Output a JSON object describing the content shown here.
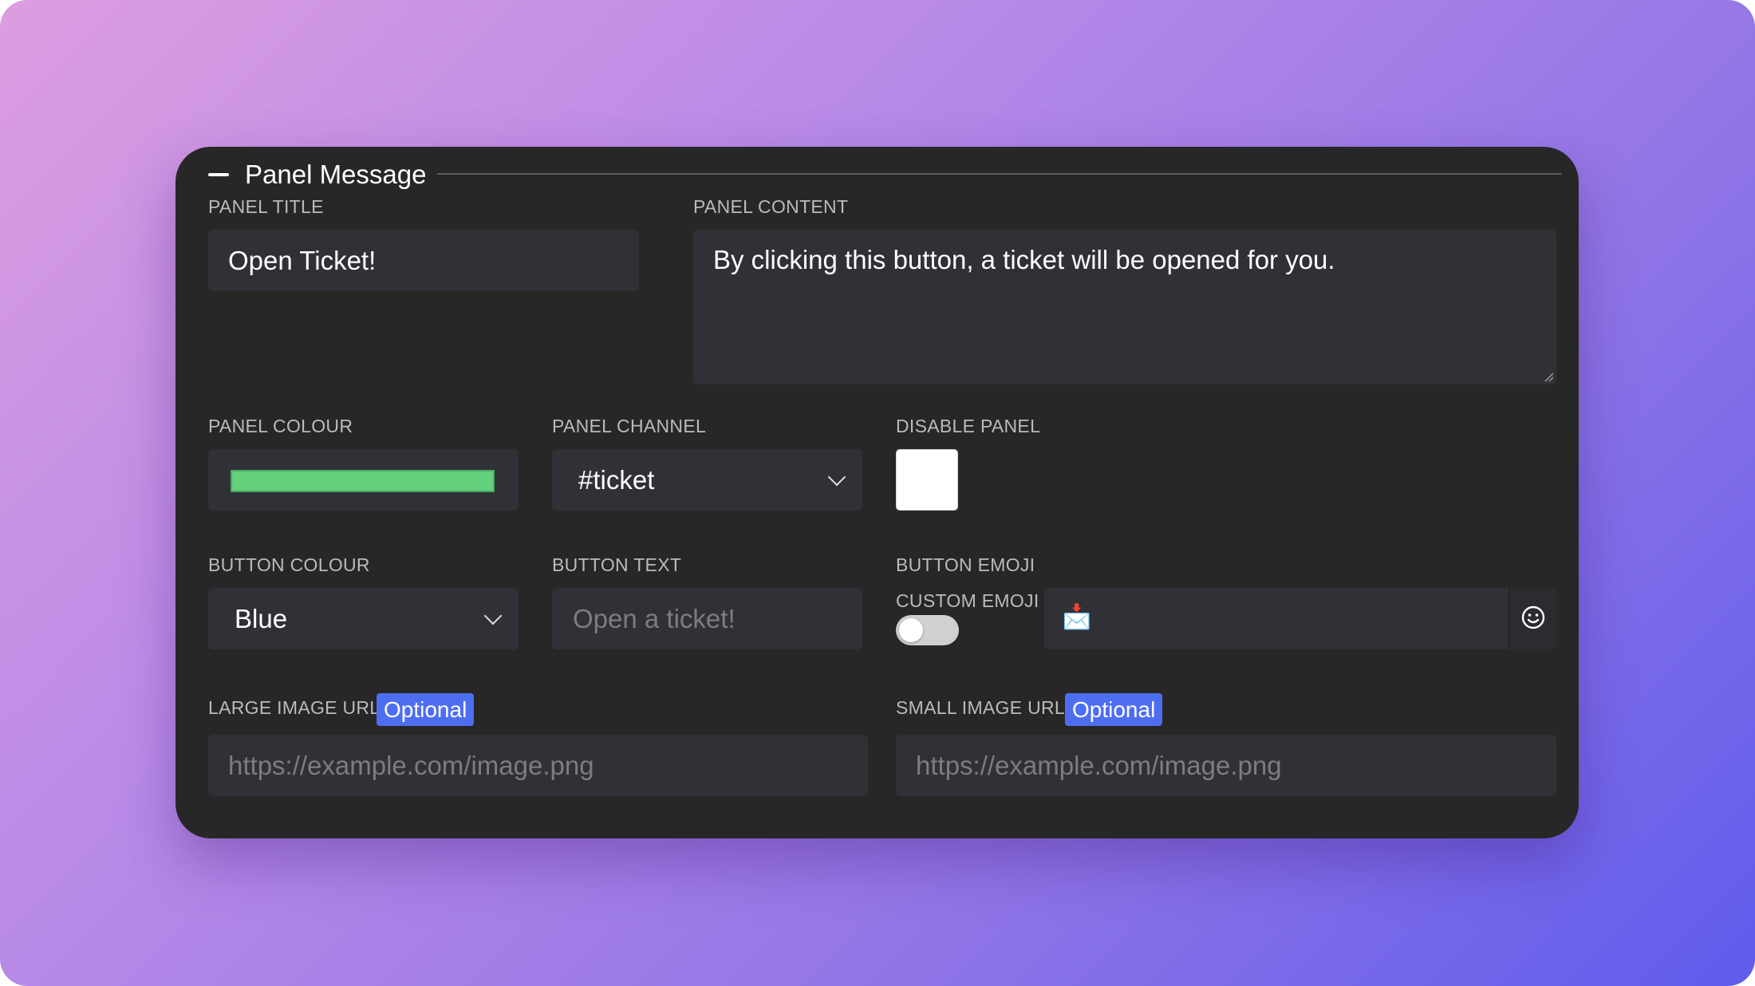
{
  "panel": {
    "title": "Panel Message"
  },
  "fields": {
    "panel_title": {
      "label": "PANEL TITLE",
      "value": "Open Ticket!"
    },
    "panel_content": {
      "label": "PANEL CONTENT",
      "value": "By clicking this button, a ticket will be opened for you."
    },
    "panel_colour": {
      "label": "PANEL COLOUR",
      "value": "#64cf7c"
    },
    "panel_channel": {
      "label": "PANEL CHANNEL",
      "value": "#ticket"
    },
    "disable_panel": {
      "label": "DISABLE PANEL",
      "checked": false
    },
    "button_colour": {
      "label": "BUTTON COLOUR",
      "value": "Blue"
    },
    "button_text": {
      "label": "BUTTON TEXT",
      "placeholder": "Open a ticket!"
    },
    "button_emoji": {
      "label": "BUTTON EMOJI",
      "custom_label": "CUSTOM EMOJI",
      "custom_enabled": false,
      "value": "📩",
      "picker_icon": "smiley-icon"
    },
    "large_image_url": {
      "label": "LARGE IMAGE URL",
      "badge": "Optional",
      "placeholder": "https://example.com/image.png"
    },
    "small_image_url": {
      "label": "SMALL IMAGE URL",
      "badge": "Optional",
      "placeholder": "https://example.com/image.png"
    }
  },
  "colors": {
    "card_bg": "#272727",
    "field_bg": "#303136",
    "badge_bg": "#4e6ef2",
    "panel_colour_swatch": "#64cf7c"
  }
}
